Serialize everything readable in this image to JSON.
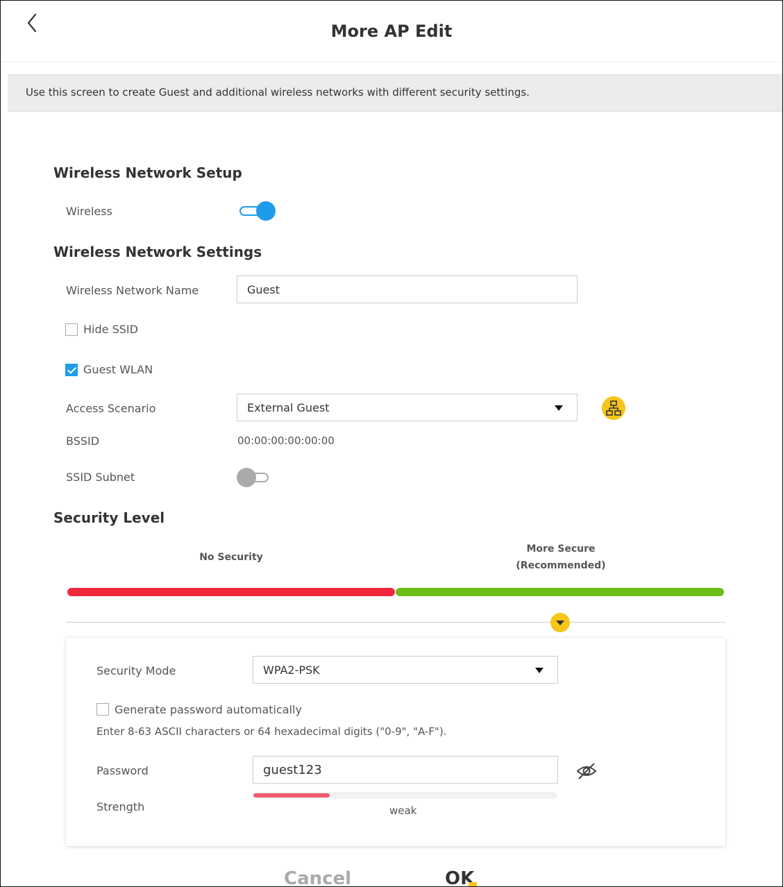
{
  "header": {
    "title": "More AP Edit"
  },
  "info": {
    "text": "Use this screen to create Guest and additional wireless networks with different security settings."
  },
  "setup": {
    "section_title": "Wireless Network Setup",
    "wireless_label": "Wireless",
    "wireless_enabled": true
  },
  "settings": {
    "section_title": "Wireless Network Settings",
    "network_name_label": "Wireless Network Name",
    "network_name_value": "Guest",
    "hide_ssid_label": "Hide SSID",
    "hide_ssid_checked": false,
    "guest_wlan_label": "Guest WLAN",
    "guest_wlan_checked": true,
    "access_scenario_label": "Access Scenario",
    "access_scenario_value": "External Guest",
    "bssid_label": "BSSID",
    "bssid_value": "00:00:00:00:00:00",
    "ssid_subnet_label": "SSID Subnet",
    "ssid_subnet_enabled": false
  },
  "security": {
    "section_title": "Security Level",
    "no_security_label": "No Security",
    "more_secure_label": "More Secure",
    "recommended_label": "(Recommended)",
    "bar_colors": {
      "low": "#f0283c",
      "high": "#6cbd1a"
    },
    "mode_label": "Security Mode",
    "mode_value": "WPA2-PSK",
    "generate_label": "Generate password automatically",
    "generate_checked": false,
    "hint": "Enter 8-63 ASCII characters or 64 hexadecimal digits (\"0-9\", \"A-F\").",
    "password_label": "Password",
    "password_value": "guest123",
    "strength_label": "Strength",
    "strength_text": "weak",
    "strength_fraction": 0.25
  },
  "actions": {
    "cancel_label": "Cancel",
    "ok_label": "OK"
  },
  "colors": {
    "accent": "#1e9be9",
    "highlight": "#f5c518"
  },
  "icons": [
    "back-chevron-icon",
    "network-topology-icon",
    "expand-arrow-icon",
    "eye-off-icon"
  ]
}
